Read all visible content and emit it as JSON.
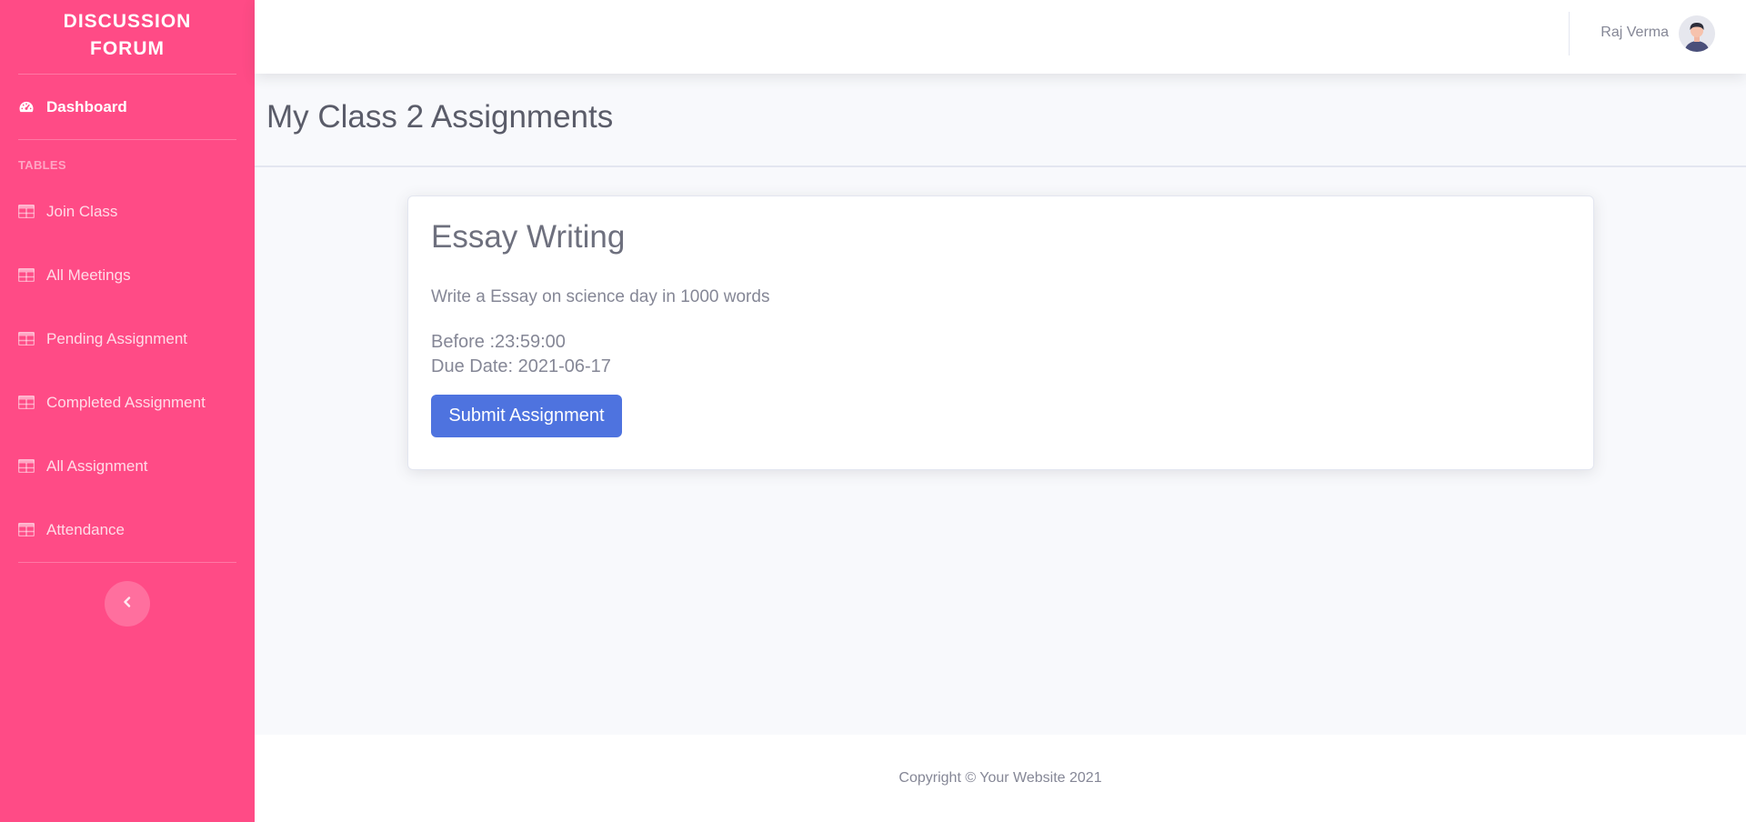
{
  "sidebar": {
    "brand_line1": "DISCUSSION",
    "brand_line2": "FORUM",
    "dashboard_label": "Dashboard",
    "section_heading": "TABLES",
    "items": [
      {
        "label": "Join Class",
        "icon": "table-icon"
      },
      {
        "label": "All Meetings",
        "icon": "table-icon"
      },
      {
        "label": "Pending Assignment",
        "icon": "table-icon"
      },
      {
        "label": "Completed Assignment",
        "icon": "table-icon"
      },
      {
        "label": "All Assignment",
        "icon": "table-icon"
      },
      {
        "label": "Attendance",
        "icon": "table-icon"
      }
    ],
    "toggle_icon": "chevron-left-icon"
  },
  "topbar": {
    "user_name": "Raj Verma",
    "avatar_icon": "user-avatar"
  },
  "page": {
    "title": "My Class 2 Assignments"
  },
  "assignment": {
    "title": "Essay Writing",
    "description": "Write a Essay on science day in 1000 words",
    "before": "Before :23:59:00",
    "due_date": "Due Date: 2021-06-17",
    "submit_label": "Submit Assignment"
  },
  "footer": {
    "copyright": "Copyright © Your Website 2021"
  },
  "colors": {
    "sidebar_bg": "#ff4b86",
    "primary_button": "#4e73df",
    "page_bg": "#f8f9fc"
  }
}
